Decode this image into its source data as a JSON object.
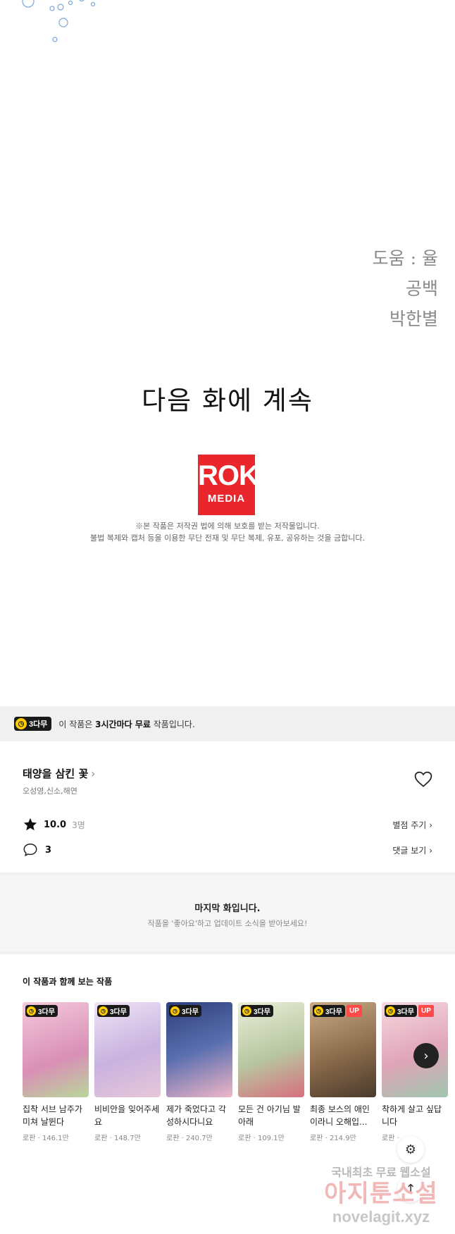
{
  "comic": {
    "credits": [
      "도움 : 율",
      "공백",
      "박한별"
    ],
    "continue_text": "다음 화에 계속",
    "logo": {
      "big": "ROK",
      "small": "MEDIA",
      "color": "#e8262b"
    },
    "notice_lines": [
      "※본 작품은 저작권 법에 의해 보호를 받는 저작물입니다.",
      "불법 복제와 캡처 등을 이용한 무단 전재 및 무단 복제, 유포, 공유하는 것을 금합니다."
    ]
  },
  "free_banner": {
    "badge": "3다무",
    "text_prefix": "이 작품은 ",
    "text_bold": "3시간마다 무료",
    "text_suffix": " 작품입니다."
  },
  "work": {
    "title": "태양을 삼킨 꽃",
    "authors": "오성영,신소,해연",
    "rating": "10.0",
    "rating_count": "3명",
    "rate_link": "별점 주기",
    "comment_count": "3",
    "comment_link": "댓글 보기"
  },
  "last_episode": {
    "title": "마지막 화입니다.",
    "subtitle": "작품을 '좋아요'하고 업데이트 소식을 받아보세요!"
  },
  "related": {
    "title": "이 작품과 함께 보는 작품",
    "items": [
      {
        "title": "집착 서브 남주가 미쳐 날뛴다",
        "genre": "로판",
        "views": "146.1만",
        "badge": "3다무",
        "up": false,
        "color": "#d98fb6"
      },
      {
        "title": "비비안을 잊어주세요",
        "genre": "로판",
        "views": "148.7만",
        "badge": "3다무",
        "up": false,
        "color": "#c9b2e0"
      },
      {
        "title": "제가 죽었다고 각성하시다니요",
        "genre": "로판",
        "views": "240.7만",
        "badge": "3다무",
        "up": false,
        "color": "#5a6fb0"
      },
      {
        "title": "모든 건 아기님 발 아래",
        "genre": "로판",
        "views": "109.1만",
        "badge": "3다무",
        "up": false,
        "color": "#b8c7a0"
      },
      {
        "title": "최종 보스의 애인이라니 오해입...",
        "genre": "로판",
        "views": "214.9만",
        "badge": "3다무",
        "up": true,
        "up_label": "UP",
        "color": "#8a6a4a"
      },
      {
        "title": "착하게 살고 싶답니다",
        "genre": "로판",
        "views": "",
        "badge": "3다무",
        "up": true,
        "up_label": "UP",
        "color": "#e0a5b8"
      }
    ]
  },
  "watermark": {
    "line1": "국내최초 무료 웹소설",
    "line2": "아지툰소설",
    "line3": "novelagit.xyz"
  }
}
